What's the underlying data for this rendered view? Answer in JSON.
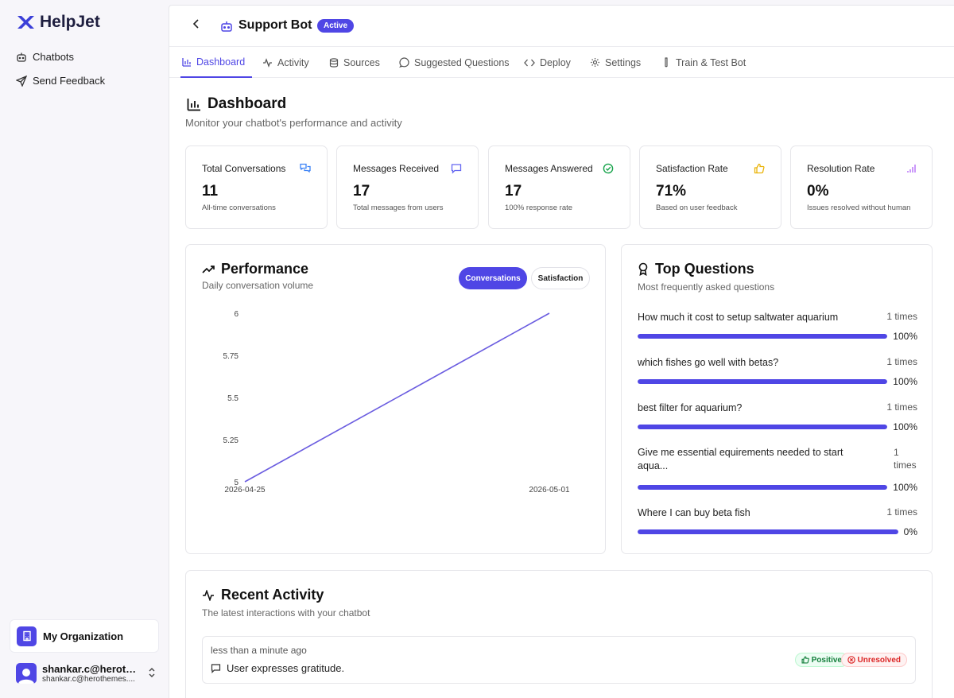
{
  "app": {
    "name": "HelpJet"
  },
  "sidebar": {
    "items": [
      {
        "label": "Chatbots",
        "icon": "bot-icon"
      },
      {
        "label": "Send Feedback",
        "icon": "send-icon"
      }
    ],
    "organization": "My Organization",
    "user": {
      "name": "shankar.c@herothe...",
      "email": "shankar.c@herothemes...."
    }
  },
  "header": {
    "title": "Support Bot",
    "status": "Active"
  },
  "tabs": [
    {
      "label": "Dashboard",
      "icon": "bar-chart-icon",
      "active": true
    },
    {
      "label": "Activity",
      "icon": "activity-icon"
    },
    {
      "label": "Sources",
      "icon": "database-icon"
    },
    {
      "label": "Suggested Questions",
      "icon": "message-circle-icon"
    },
    {
      "label": "Deploy",
      "icon": "code-icon"
    },
    {
      "label": "Settings",
      "icon": "gear-icon"
    },
    {
      "label": "Train & Test Bot",
      "icon": "flask-icon"
    }
  ],
  "dashboard": {
    "title": "Dashboard",
    "subtitle": "Monitor your chatbot's performance and activity"
  },
  "stats": [
    {
      "label": "Total Conversations",
      "value": "11",
      "note": "All-time conversations",
      "icon": "messages-icon",
      "color": "#3b82f6"
    },
    {
      "label": "Messages Received",
      "value": "17",
      "note": "Total messages from users",
      "icon": "message-square-icon",
      "color": "#6366f1"
    },
    {
      "label": "Messages Answered",
      "value": "17",
      "note": "100% response rate",
      "icon": "check-circle-icon",
      "color": "#16a34a"
    },
    {
      "label": "Satisfaction Rate",
      "value": "71%",
      "note": "Based on user feedback",
      "icon": "thumbs-up-icon",
      "color": "#eab308"
    },
    {
      "label": "Resolution Rate",
      "value": "0%",
      "note": "Issues resolved without human",
      "icon": "bar-chart-small-icon",
      "color": "#a855f7"
    }
  ],
  "performance": {
    "title": "Performance",
    "subtitle": "Daily conversation volume",
    "toggle": {
      "conversations": "Conversations",
      "satisfaction": "Satisfaction"
    }
  },
  "chart_data": {
    "type": "line",
    "x": [
      "2026-04-25",
      "2026-05-01"
    ],
    "series": [
      {
        "values": [
          5,
          6
        ],
        "color": "#6b5de0"
      }
    ],
    "y_ticks": [
      "6",
      "5.75",
      "5.5",
      "5.25",
      "5"
    ],
    "ylim": [
      5,
      6
    ],
    "grid": false,
    "title": "",
    "xlabel": "",
    "ylabel": ""
  },
  "top_questions": {
    "title": "Top Questions",
    "subtitle": "Most frequently asked questions",
    "items": [
      {
        "question": "How much it cost to setup saltwater aquarium",
        "count": "1 times",
        "pct": "100%",
        "fill": 1.0
      },
      {
        "question": "which fishes go well with betas?",
        "count": "1 times",
        "pct": "100%",
        "fill": 1.0
      },
      {
        "question": "best filter for aquarium?",
        "count": "1 times",
        "pct": "100%",
        "fill": 1.0
      },
      {
        "question": "Give me essential equirements needed to start aqua...",
        "count": "1 times",
        "pct": "100%",
        "fill": 1.0
      },
      {
        "question": "Where I can buy beta fish",
        "count": "1 times",
        "pct": "0%",
        "fill": 1.0
      }
    ]
  },
  "recent_activity": {
    "title": "Recent Activity",
    "subtitle": "The latest interactions with your chatbot",
    "items": [
      {
        "time": "less than a minute ago",
        "message": "User expresses gratitude.",
        "sentiment": "Positive",
        "status": "Unresolved"
      }
    ]
  }
}
